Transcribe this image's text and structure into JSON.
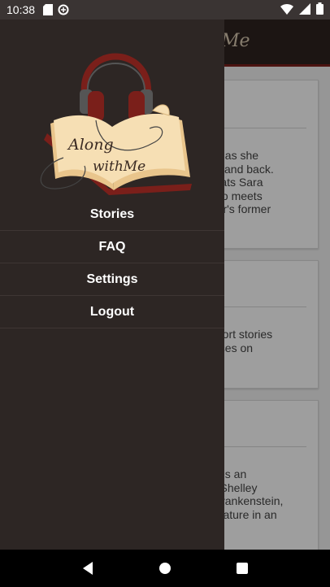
{
  "status_bar": {
    "time": "10:38",
    "left_icons": [
      "sd-card-icon",
      "sync-icon"
    ],
    "right_icons": [
      "wifi-icon",
      "signal-icon",
      "battery-icon"
    ]
  },
  "app": {
    "toolbar_title_fragment": "Me",
    "cards": [
      {
        "text": "we as she\nor) and back.\ntreats Sara\nalso meets\nther's former"
      },
      {
        "text": " short stories\ncuses on\ne."
      },
      {
        "text": "us is an\nry Shelley\nr Frankenstein,\ncreature in an"
      }
    ]
  },
  "drawer": {
    "logo_text_line1": "Along",
    "logo_text_line2": "withMe",
    "menu": [
      {
        "label": "Stories",
        "name": "menu-item-stories"
      },
      {
        "label": "FAQ",
        "name": "menu-item-faq"
      },
      {
        "label": "Settings",
        "name": "menu-item-settings"
      },
      {
        "label": "Logout",
        "name": "menu-item-logout"
      }
    ]
  },
  "nav_bar": {
    "buttons": [
      "back-icon",
      "home-icon",
      "recents-icon"
    ]
  },
  "colors": {
    "drawer_bg": "#2d2624",
    "toolbar_bg": "#2e2320",
    "accent_red": "#7a1f1a",
    "book_page": "#f3d9a8"
  }
}
